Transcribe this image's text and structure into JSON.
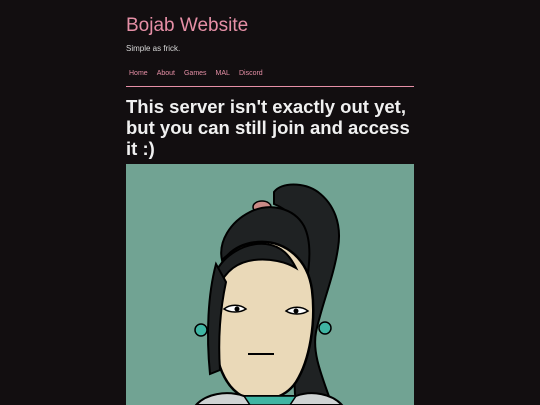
{
  "site": {
    "title": "Bojab Website",
    "subtitle": "Simple as frick."
  },
  "nav": {
    "items": [
      {
        "label": "Home"
      },
      {
        "label": "About"
      },
      {
        "label": "Games"
      },
      {
        "label": "MAL"
      },
      {
        "label": "Discord"
      }
    ]
  },
  "main": {
    "headline": "This server isn't exactly out yet, but you can still join and access it :)"
  },
  "colors": {
    "background": "#120e10",
    "accent": "#e68fa6",
    "image_background": "#71a393"
  }
}
